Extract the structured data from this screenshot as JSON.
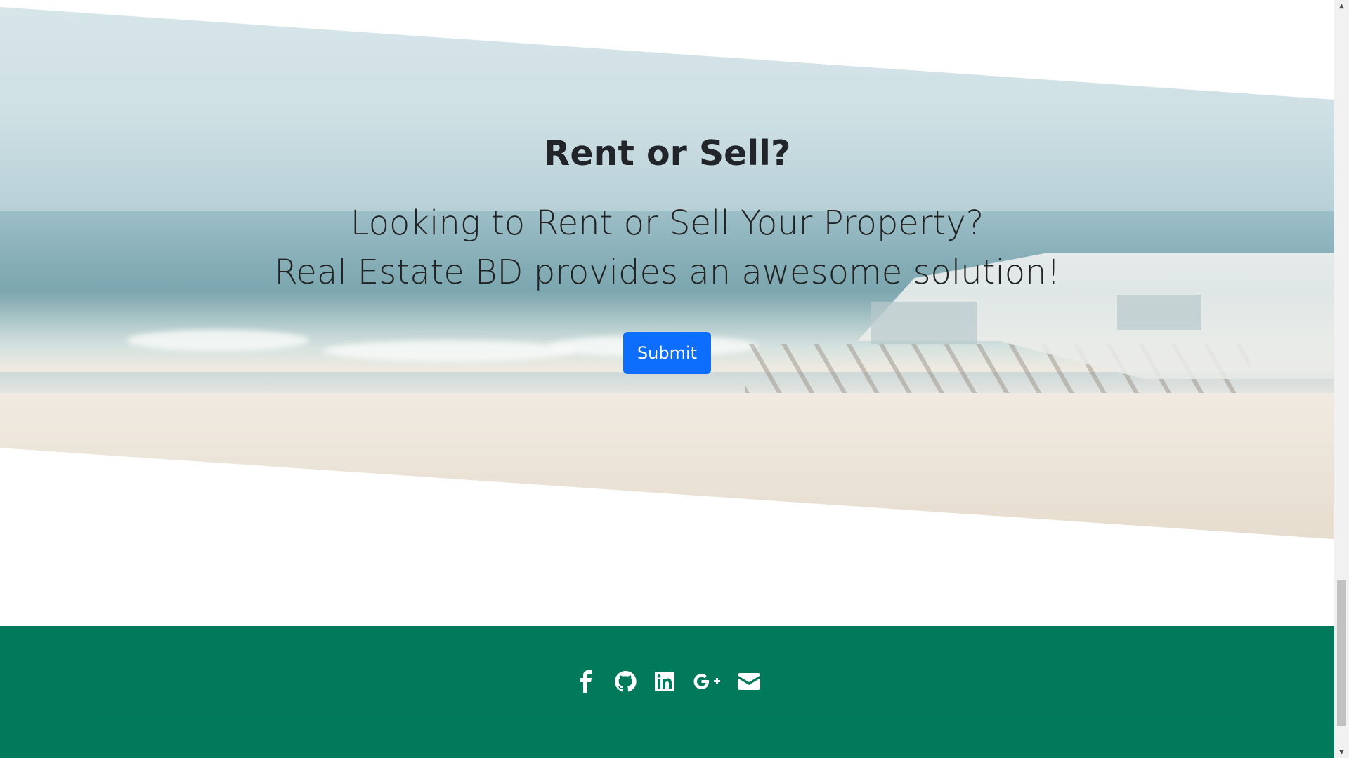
{
  "hero": {
    "title": "Rent or Sell?",
    "line1": "Looking to Rent or Sell Your Property?",
    "line2": "Real Estate BD provides an awesome solution!",
    "submit_label": "Submit"
  },
  "footer": {
    "background_color": "#017a5c",
    "icons": [
      "facebook-icon",
      "github-icon",
      "linkedin-icon",
      "google-plus-icon",
      "envelope-icon"
    ]
  },
  "colors": {
    "button": "#0d6efd",
    "footer": "#017a5c"
  },
  "scrollbar": {
    "up_arrow": "▲",
    "down_arrow": "▼"
  }
}
